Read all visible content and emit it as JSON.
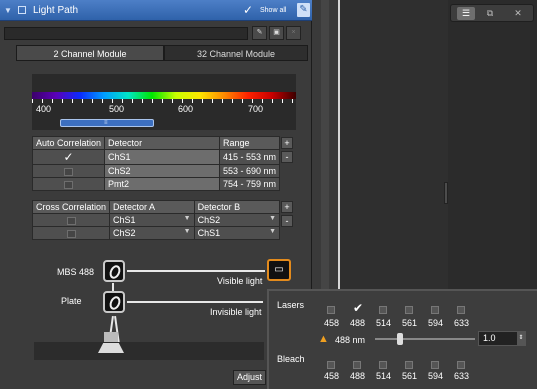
{
  "header": {
    "collapse_icon": "triangle-down-icon",
    "title": "Light Path",
    "show_all": "Show all",
    "checkmark": "✓"
  },
  "tabs": [
    "2 Channel Module",
    "32 Channel Module"
  ],
  "spectrum": {
    "ticks": [
      "400",
      "500",
      "600",
      "700"
    ],
    "grip": "≡"
  },
  "auto_table": {
    "headers": [
      "Auto Correlation",
      "Detector",
      "Range"
    ],
    "plus": "+",
    "minus": "-",
    "rows": [
      {
        "checked": true,
        "detector": "ChS1",
        "range": "415 - 553 nm"
      },
      {
        "checked": false,
        "detector": "ChS2",
        "range": "553 - 690 nm"
      },
      {
        "checked": false,
        "detector": "Pmt2",
        "range": "754 - 759 nm"
      }
    ]
  },
  "cross_table": {
    "headers": [
      "Cross Correlation",
      "Detector A",
      "Detector B"
    ],
    "plus": "+",
    "minus": "-",
    "rows": [
      {
        "a": "ChS1",
        "b": "ChS2"
      },
      {
        "a": "ChS2",
        "b": "ChS1"
      }
    ]
  },
  "lightpath": {
    "mbs": "MBS 488",
    "plate": "Plate",
    "visible": "Visible light",
    "invisible": "Invisible light",
    "adjust": "Adjust"
  },
  "popup": {
    "lasers_label": "Lasers",
    "bleach_label": "Bleach",
    "wavelengths": [
      "458",
      "488",
      "514",
      "561",
      "594",
      "633"
    ],
    "laser_checked": [
      false,
      true,
      false,
      false,
      false,
      false
    ],
    "warning": "488 nm",
    "value": "1.0"
  }
}
